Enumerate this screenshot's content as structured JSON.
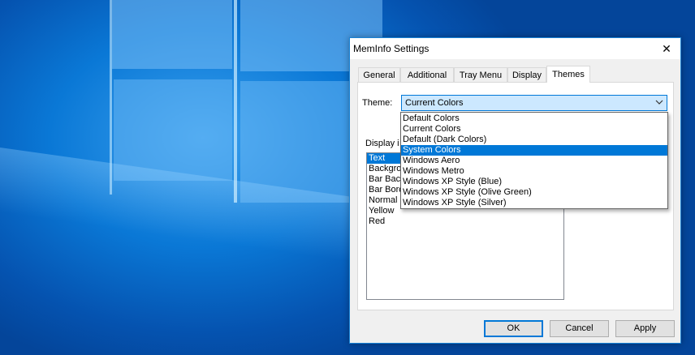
{
  "window": {
    "title": "MemInfo Settings",
    "close_glyph": "✕"
  },
  "tabs": [
    {
      "label": "General"
    },
    {
      "label": "Additional"
    },
    {
      "label": "Tray Menu"
    },
    {
      "label": "Display"
    },
    {
      "label": "Themes"
    }
  ],
  "active_tab": "Themes",
  "theme": {
    "label": "Theme:",
    "selected": "Current Colors",
    "chevron_icon": "chevron-down-icon",
    "options": [
      "Default Colors",
      "Current Colors",
      "Default (Dark Colors)",
      "System Colors",
      "Windows Aero",
      "Windows Metro",
      "Windows XP Style (Blue)",
      "Windows XP Style (Olive Green)",
      "Windows XP Style (Silver)"
    ],
    "highlighted_option": "System Colors"
  },
  "display_items": {
    "label": "Display i",
    "items": [
      "Text",
      "Backgro",
      "Bar Back",
      "Bar Bord",
      "Normal",
      "Yellow",
      "Red"
    ],
    "selected": "Text"
  },
  "buttons": {
    "ok": "OK",
    "cancel": "Cancel",
    "apply": "Apply"
  },
  "colors": {
    "accent": "#0078d7",
    "selection_bg": "#cce8ff",
    "dialog_bg": "#f0f0f0"
  }
}
